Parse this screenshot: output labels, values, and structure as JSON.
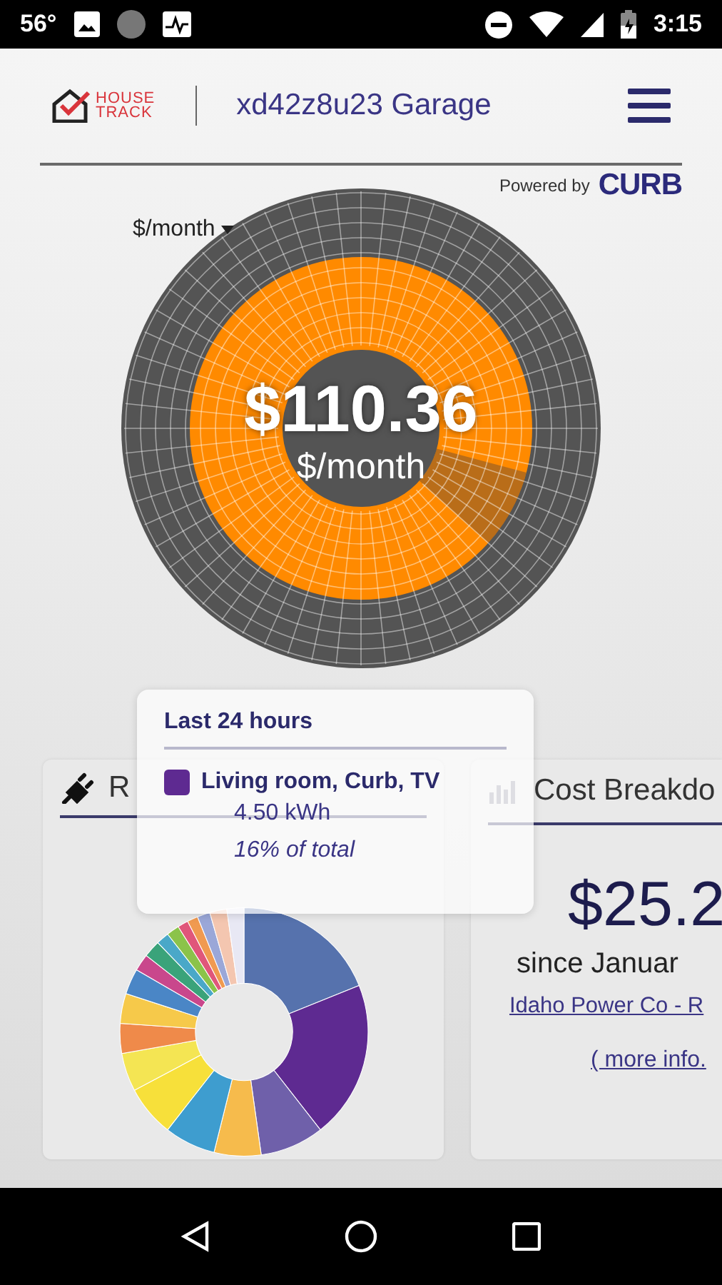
{
  "status_bar": {
    "temperature": "56°",
    "time": "3:15"
  },
  "header": {
    "logo": [
      "HOUSE",
      "TRACK"
    ],
    "title": "xd42z8u23 Garage",
    "powered_by": "Powered by",
    "brand": "CURB"
  },
  "gauge": {
    "unit_selector": "$/month",
    "amount": "$110.36",
    "unit": "$/month"
  },
  "cards": [
    {
      "kind": "usage",
      "title": "R"
    },
    {
      "kind": "cost",
      "title": "Cost Breakdo",
      "amount": "$25.2",
      "period": "since Januar",
      "provider": "Idaho Power Co - R",
      "more": "( more info."
    }
  ],
  "tooltip": {
    "heading": "Last 24 hours",
    "item": {
      "label": "Living room, Curb, TV",
      "color": "#5e2a91"
    },
    "usage": "4.50 kWh",
    "share": "16% of total"
  }
}
